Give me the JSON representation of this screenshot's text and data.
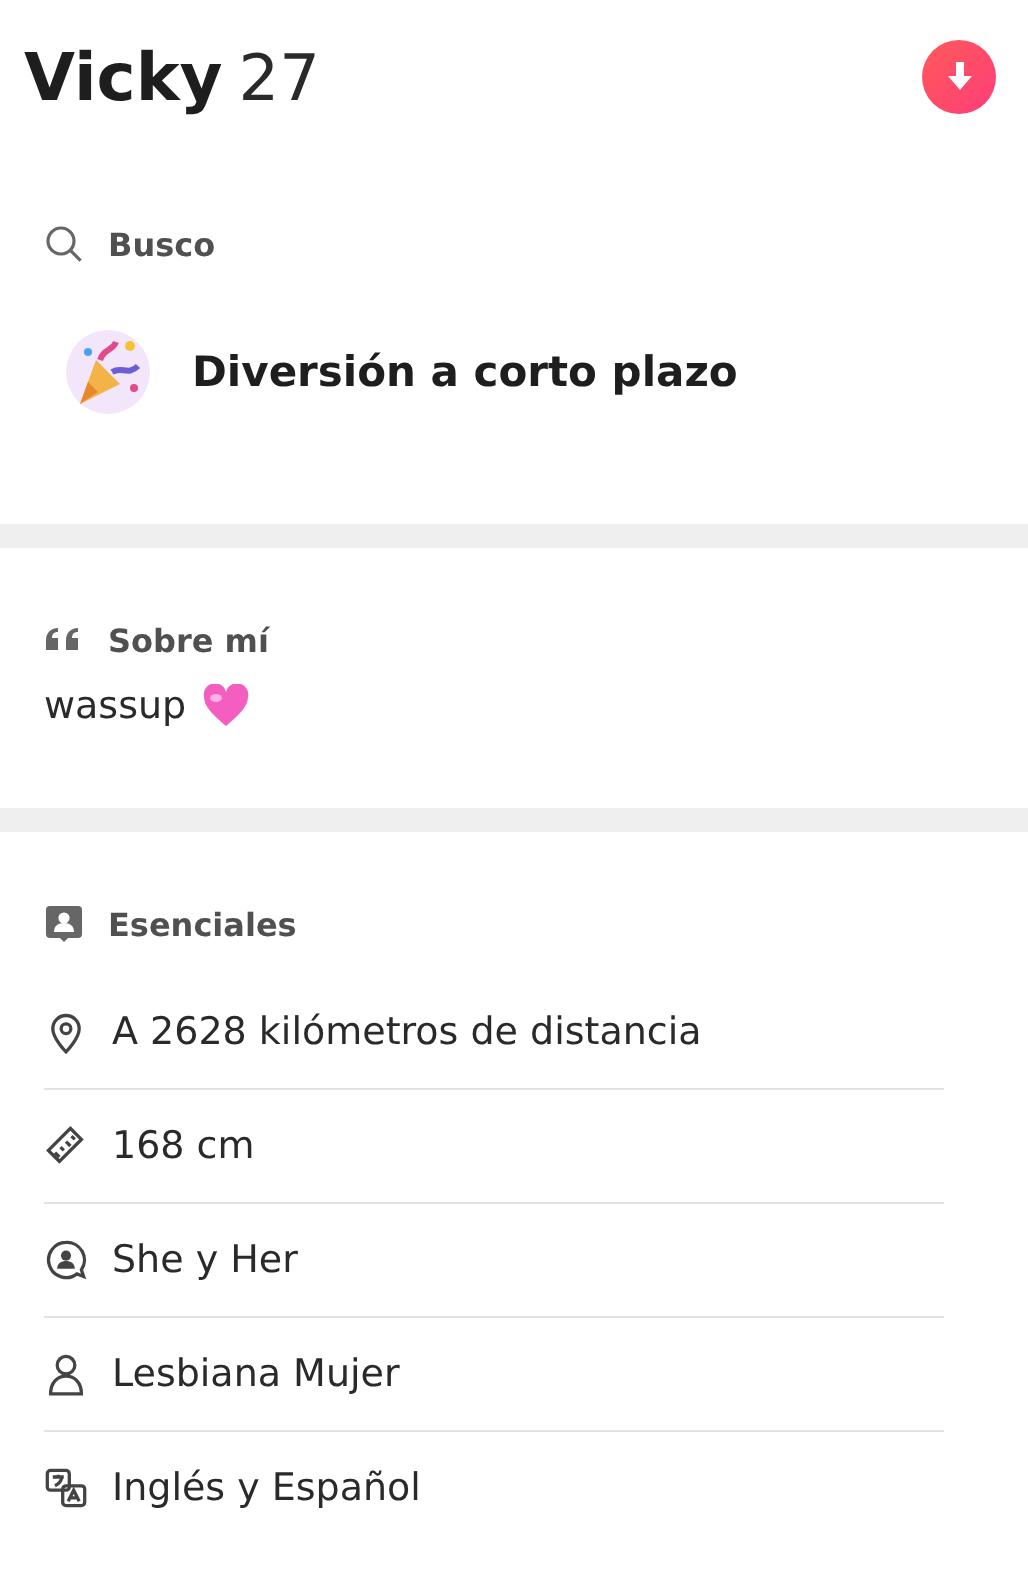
{
  "profile": {
    "name": "Vicky",
    "age": "27"
  },
  "looking_for": {
    "heading": "Busco",
    "value": "Diversión a corto plazo"
  },
  "about": {
    "heading": "Sobre mí",
    "text": "wassup"
  },
  "essentials": {
    "heading": "Esenciales",
    "items": [
      {
        "kind": "distance",
        "text": "A 2628 kilómetros de distancia"
      },
      {
        "kind": "height",
        "text": "168 cm"
      },
      {
        "kind": "pronouns",
        "text": "She y Her"
      },
      {
        "kind": "orientation",
        "text": "Lesbiana Mujer"
      },
      {
        "kind": "languages",
        "text": "Inglés y Español"
      }
    ]
  }
}
